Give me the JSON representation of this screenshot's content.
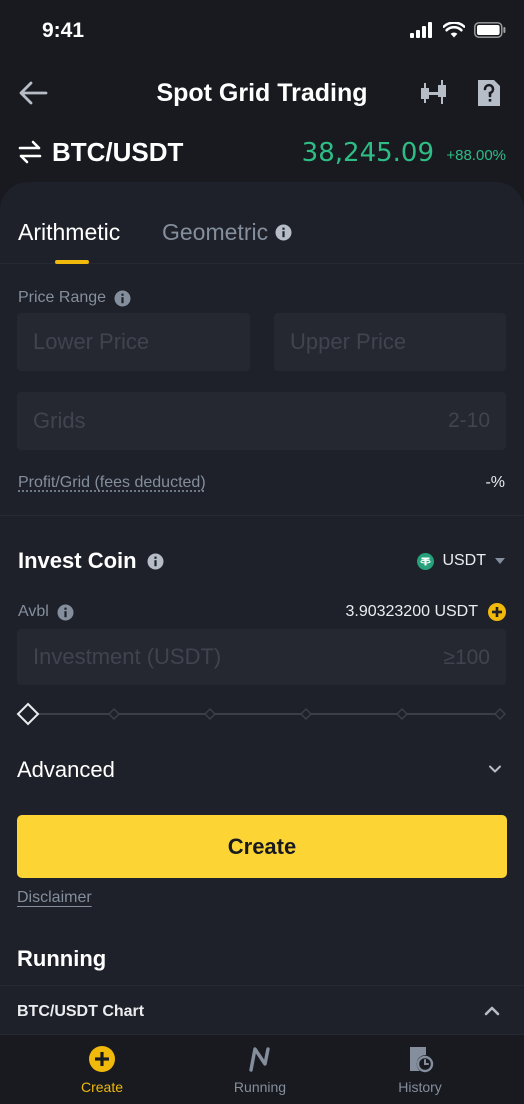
{
  "status_bar": {
    "time": "9:41"
  },
  "header": {
    "title": "Spot Grid Trading"
  },
  "pair": {
    "name": "BTC/USDT",
    "price": "38,245.09",
    "change": "+88.00%"
  },
  "tabs": [
    {
      "label": "Arithmetic",
      "active": true
    },
    {
      "label": "Geometric",
      "active": false
    }
  ],
  "price_range": {
    "label": "Price Range",
    "lower_placeholder": "Lower Price",
    "upper_placeholder": "Upper Price"
  },
  "grids": {
    "placeholder": "Grids",
    "range": "2-10"
  },
  "profit": {
    "label": "Profit/Grid (fees deducted)",
    "value": "-%"
  },
  "invest": {
    "title": "Invest Coin",
    "coin": "USDT",
    "avbl_label": "Avbl",
    "avbl_value": "3.90323200 USDT",
    "investment_placeholder": "Investment (USDT)",
    "min": "≥100",
    "slider_percent": 0
  },
  "advanced": {
    "label": "Advanced"
  },
  "create_button": {
    "label": "Create"
  },
  "disclaimer": {
    "label": "Disclaimer"
  },
  "running": {
    "title": "Running",
    "chart_label": "BTC/USDT Chart"
  },
  "bottom_nav": [
    {
      "label": "Create",
      "icon": "plus-circle-icon",
      "active": true
    },
    {
      "label": "Running",
      "icon": "running-icon",
      "active": false
    },
    {
      "label": "History",
      "icon": "history-icon",
      "active": false
    }
  ],
  "colors": {
    "background": "#181a20",
    "panel": "#1e2129",
    "accent": "#f0b90b",
    "button": "#fcd535",
    "positive": "#2ebd85",
    "muted": "#848e9c",
    "tether": "#26a17b"
  }
}
